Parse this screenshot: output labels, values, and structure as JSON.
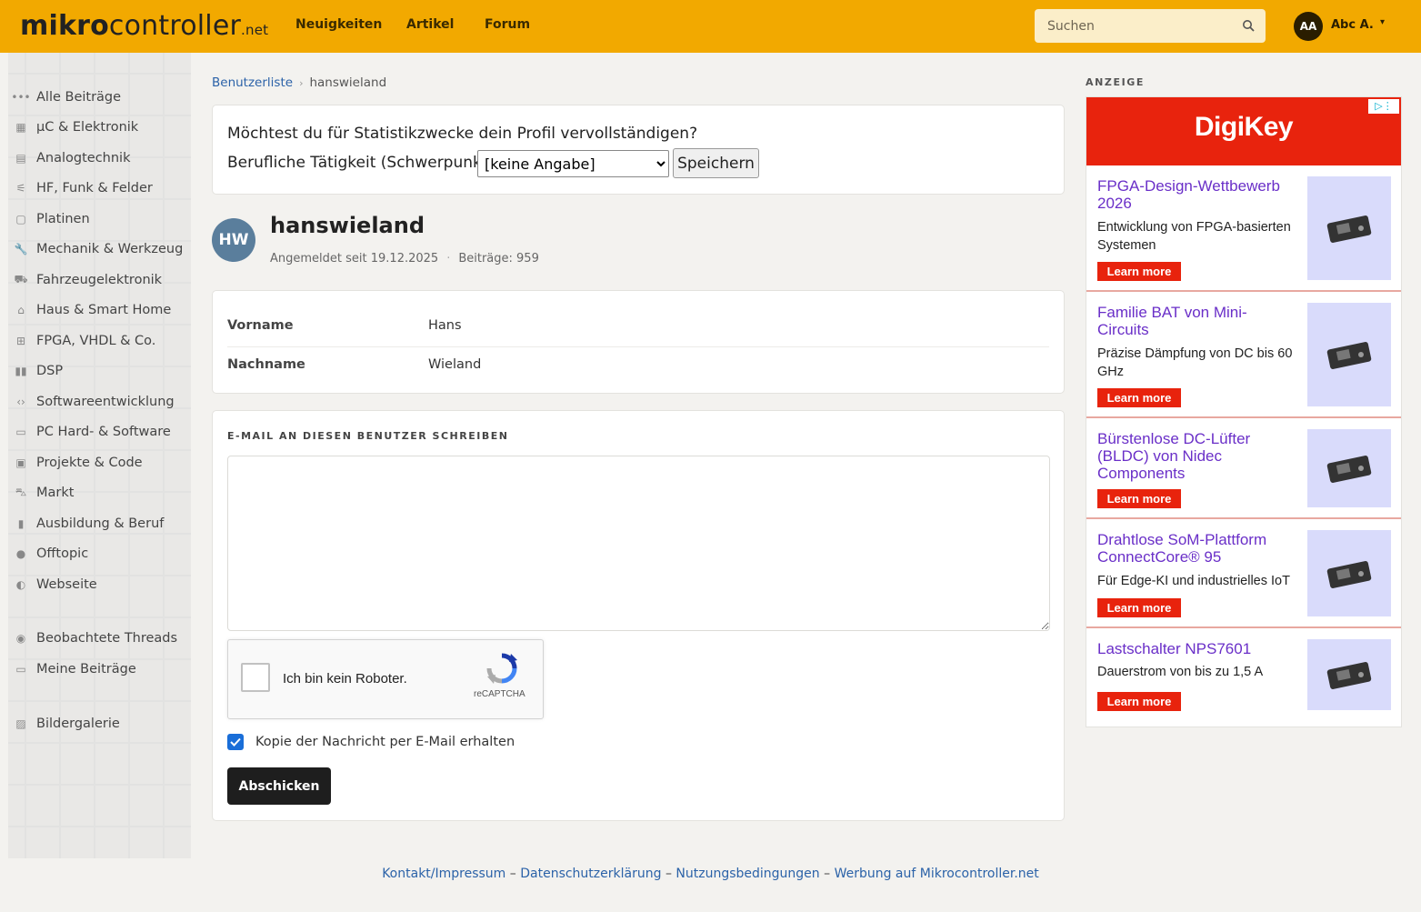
{
  "header": {
    "logo_main": "mikro",
    "logo_rest": "controller",
    "logo_suffix": ".net",
    "nav": [
      "Neuigkeiten",
      "Artikel",
      "Forum"
    ],
    "search_placeholder": "Suchen",
    "user_initials": "AA",
    "user_name": "Abc A."
  },
  "sidebar": {
    "items": [
      {
        "label": "Alle Beiträge",
        "icon": "dots-icon"
      },
      {
        "label": "µC & Elektronik",
        "icon": "chip-icon"
      },
      {
        "label": "Analogtechnik",
        "icon": "analog-icon"
      },
      {
        "label": "HF, Funk & Felder",
        "icon": "antenna-icon"
      },
      {
        "label": "Platinen",
        "icon": "board-icon"
      },
      {
        "label": "Mechanik & Werkzeug",
        "icon": "wrench-icon"
      },
      {
        "label": "Fahrzeugelektronik",
        "icon": "car-icon"
      },
      {
        "label": "Haus & Smart Home",
        "icon": "house-icon"
      },
      {
        "label": "FPGA, VHDL & Co.",
        "icon": "fpga-icon"
      },
      {
        "label": "DSP",
        "icon": "waveform-icon"
      },
      {
        "label": "Softwareentwicklung",
        "icon": "code-icon"
      },
      {
        "label": "PC Hard- & Software",
        "icon": "laptop-icon"
      },
      {
        "label": "Projekte & Code",
        "icon": "project-icon"
      },
      {
        "label": "Markt",
        "icon": "cart-icon"
      },
      {
        "label": "Ausbildung & Beruf",
        "icon": "book-icon"
      },
      {
        "label": "Offtopic",
        "icon": "chat-icon"
      },
      {
        "label": "Webseite",
        "icon": "globe-icon"
      }
    ],
    "secondary": [
      {
        "label": "Beobachtete Threads",
        "icon": "eye-icon"
      },
      {
        "label": "Meine Beiträge",
        "icon": "comment-icon"
      }
    ],
    "gallery": {
      "label": "Bildergalerie",
      "icon": "image-icon"
    }
  },
  "breadcrumb": {
    "parent": "Benutzerliste",
    "current": "hanswieland"
  },
  "profile_prompt": {
    "question": "Möchtest du für Statistikzwecke dein Profil vervollständigen?",
    "label": "Berufliche Tätigkeit (Schwerpunkt):",
    "selected": "[keine Angabe]",
    "save": "Speichern"
  },
  "user": {
    "initials": "HW",
    "name": "hanswieland",
    "joined": "Angemeldet seit 19.12.2025",
    "separator": "·",
    "posts": "Beiträge: 959"
  },
  "details": [
    {
      "key": "Vorname",
      "value": "Hans"
    },
    {
      "key": "Nachname",
      "value": "Wieland"
    }
  ],
  "mail": {
    "heading": "E-MAIL AN DIESEN BENUTZER SCHREIBEN",
    "captcha_label": "Ich bin kein Roboter.",
    "captcha_brand": "reCAPTCHA",
    "copy_label": "Kopie der Nachricht per E-Mail erhalten",
    "copy_checked": true,
    "submit": "Abschicken"
  },
  "ad": {
    "label": "ANZEIGE",
    "brand": "DigiKey",
    "button": "Learn more",
    "items": [
      {
        "title": "FPGA-Design-Wettbewerb 2026",
        "desc": "Entwicklung von FPGA-basierten Systemen"
      },
      {
        "title": "Familie BAT von Mini-Circuits",
        "desc": "Präzise Dämpfung von DC bis 60 GHz"
      },
      {
        "title": "Bürstenlose DC-Lüfter (BLDC) von Nidec Components",
        "desc": ""
      },
      {
        "title": "Drahtlose SoM-Plattform ConnectCore® 95",
        "desc": "Für Edge-KI und industrielles IoT"
      },
      {
        "title": "Lastschalter NPS7601",
        "desc": "Dauerstrom von bis zu 1,5 A"
      }
    ]
  },
  "footer": {
    "links": [
      "Kontakt/Impressum",
      "Datenschutzerklärung",
      "Nutzungsbedingungen",
      "Werbung auf Mikrocontroller.net"
    ],
    "separator": "–"
  }
}
